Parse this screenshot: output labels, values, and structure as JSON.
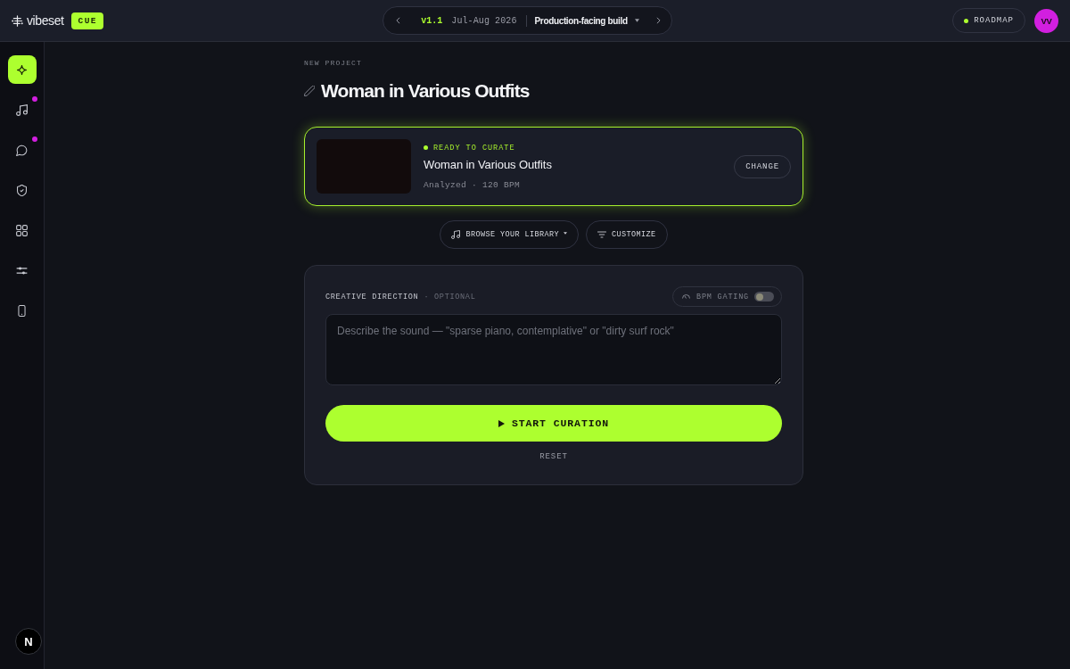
{
  "top_bar": {
    "brand": "vibeset",
    "badge": "CUE",
    "release_switcher": {
      "version": "v1.1",
      "period": "Jul-Aug 2026",
      "build": "Production-facing build"
    },
    "roadmap_button": "ROADMAP",
    "avatar": "VV"
  },
  "sidebar": {
    "items": [
      {
        "kind": "sparkle",
        "selected": true,
        "unread": false
      },
      {
        "kind": "music",
        "selected": false,
        "unread": true
      },
      {
        "kind": "chat",
        "selected": false,
        "unread": true
      },
      {
        "kind": "shield",
        "selected": false,
        "unread": false
      },
      {
        "kind": "grid",
        "selected": false,
        "unread": false
      },
      {
        "kind": "sliders",
        "selected": false,
        "unread": false
      },
      {
        "kind": "phone",
        "selected": false,
        "unread": false
      }
    ]
  },
  "page": {
    "eyebrow": "NEW PROJECT",
    "title": "Woman in Various Outfits"
  },
  "media_card": {
    "status": "READY TO CURATE",
    "title": "Woman in Various Outfits",
    "meta": "Analyzed · 120 BPM",
    "action": "CHANGE"
  },
  "source_buttons": [
    {
      "kind": "library",
      "label": "BROWSE YOUR LIBRARY",
      "dropdown": true
    },
    {
      "kind": "customize",
      "label": "CUSTOMIZE",
      "dropdown": false
    }
  ],
  "creative_direction": {
    "label": "CREATIVE DIRECTION",
    "hint": "· OPTIONAL",
    "bpm_gating": {
      "label": "BPM GATING",
      "on": false
    },
    "placeholder": "Describe the sound — \"sparse piano, contemplative\" or \"dirty surf rock\"",
    "submit": "START CURATION",
    "reset": "RESET"
  },
  "dev_indicator": "N"
}
